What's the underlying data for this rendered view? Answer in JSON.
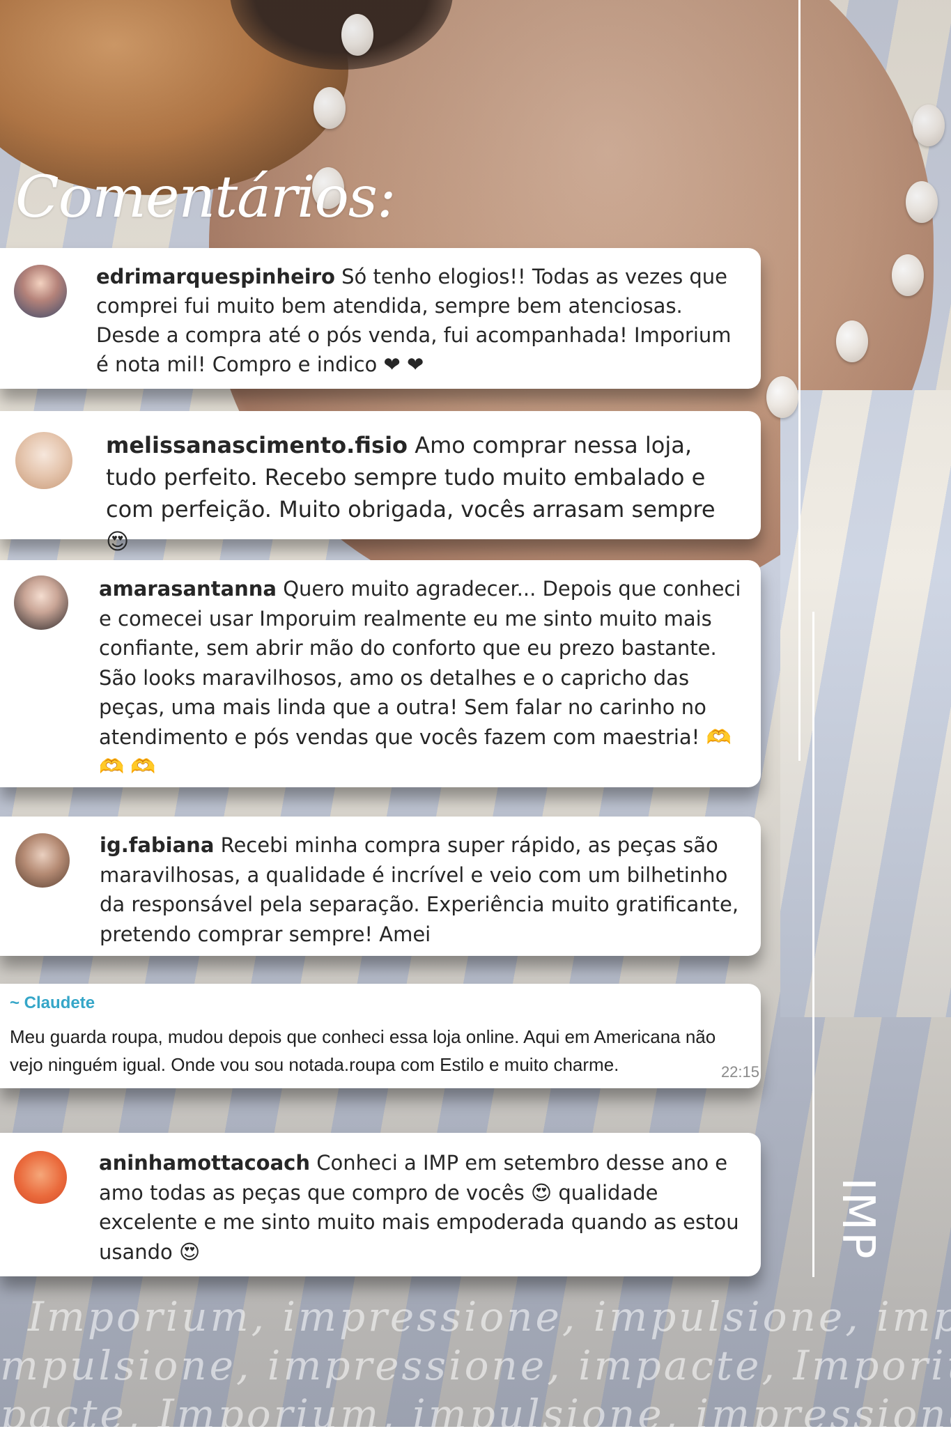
{
  "title": "Comentários:",
  "comments": [
    {
      "username": "edrimarquespinheiro",
      "text": " Só tenho elogios!! Todas as vezes que comprei fui muito bem atendida, sempre bem atenciosas. Desde a compra até o pós venda, fui acompanhada! Imporium é nota mil! Compro e indico ❤ ❤"
    },
    {
      "username": "melissanascimento.fisio",
      "text": " Amo comprar nessa loja, tudo perfeito. Recebo sempre tudo muito embalado e com perfeição. Muito obrigada, vocês arrasam sempre 😍"
    },
    {
      "username": "amarasantanna",
      "text": " Quero muito agradecer... Depois que conheci e comecei usar Imporuim realmente eu me sinto muito mais confiante, sem abrir mão do conforto que eu prezo bastante. São looks maravilhosos, amo os detalhes e o capricho das peças, uma mais linda que a outra! Sem falar no carinho no atendimento e pós vendas que vocês fazem com maestria! 🫶 🫶 🫶"
    },
    {
      "username": "ig.fabiana",
      "text": " Recebi minha compra super rápido, as peças são maravilhosas, a qualidade é incrível e veio com um bilhetinho da responsável pela separação. Experiência muito gratificante, pretendo comprar sempre! Amei"
    },
    {
      "username": "aninhamottacoach",
      "text": " Conheci a IMP em setembro desse ano e amo todas as peças que compro de vocês 😍 qualidade excelente e me sinto muito mais empoderada quando as estou usando 😍"
    }
  ],
  "message": {
    "sender": "~ Claudete",
    "text": "Meu guarda roupa, mudou depois que conheci essa loja online. Aqui em Americana não vejo ninguém igual. Onde vou sou notada.roupa com Estilo e muito charme.",
    "time": "22:15"
  },
  "logo": "IMP",
  "watermark": [
    "Imporium, impressione, impulsione, impac",
    "mpulsione, impressione, impacte, Imporium",
    "pacte, Imporium, impulsione, impressione, I"
  ],
  "colors": {
    "card": "#ffffff",
    "sender": "#35a6c8",
    "text": "#262626"
  }
}
